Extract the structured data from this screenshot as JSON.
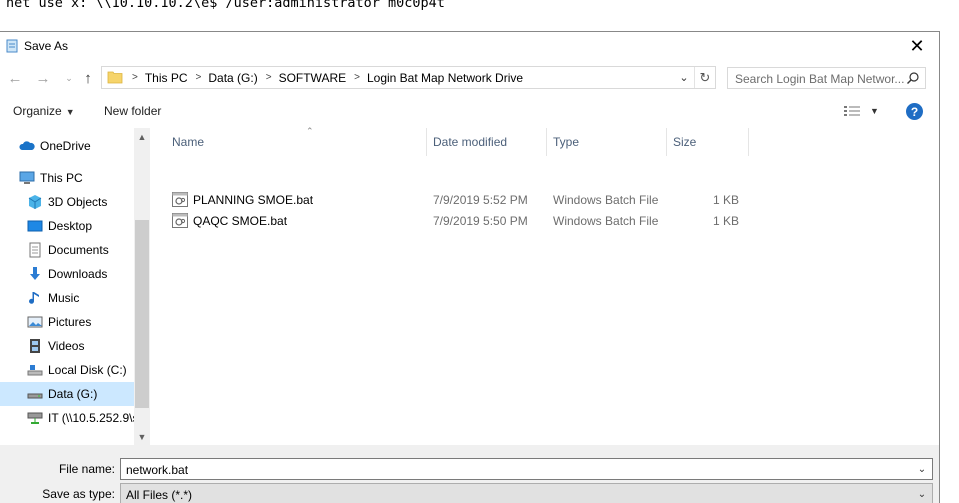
{
  "background": {
    "command_line": "net use x: \\\\10.10.10.2\\e$ /user:administrator m0c0p4t"
  },
  "dialog": {
    "title": "Save As"
  },
  "address": {
    "crumbs": [
      "This PC",
      "Data (G:)",
      "SOFTWARE",
      "Login Bat Map Network Drive"
    ]
  },
  "search": {
    "placeholder": "Search Login Bat Map Networ..."
  },
  "toolbar": {
    "organize_label": "Organize",
    "new_folder_label": "New folder"
  },
  "nav": {
    "items": [
      {
        "label": "OneDrive",
        "icon": "cloud-icon"
      },
      {
        "label": "This PC",
        "icon": "computer-icon"
      },
      {
        "label": "3D Objects",
        "icon": "cube-icon"
      },
      {
        "label": "Desktop",
        "icon": "desktop-icon"
      },
      {
        "label": "Documents",
        "icon": "document-icon"
      },
      {
        "label": "Downloads",
        "icon": "download-icon"
      },
      {
        "label": "Music",
        "icon": "music-note-icon"
      },
      {
        "label": "Pictures",
        "icon": "picture-icon"
      },
      {
        "label": "Videos",
        "icon": "film-icon"
      },
      {
        "label": "Local Disk (C:)",
        "icon": "drive-icon"
      },
      {
        "label": "Data (G:)",
        "icon": "drive-icon"
      },
      {
        "label": "IT (\\\\10.5.252.9\\s",
        "icon": "network-drive-icon"
      }
    ]
  },
  "columns": {
    "name": "Name",
    "date": "Date modified",
    "type": "Type",
    "size": "Size"
  },
  "files": [
    {
      "name": "PLANNING SMOE.bat",
      "date": "7/9/2019 5:52 PM",
      "type": "Windows Batch File",
      "size": "1 KB"
    },
    {
      "name": "QAQC SMOE.bat",
      "date": "7/9/2019 5:50 PM",
      "type": "Windows Batch File",
      "size": "1 KB"
    }
  ],
  "fields": {
    "file_name_label": "File name:",
    "file_name_value": "network.bat",
    "save_type_label": "Save as type:",
    "save_type_value": "All Files  (*.*)"
  },
  "colors": {
    "selected": "#cce8ff",
    "header_text": "#4c607a",
    "help_blue": "#1f6dc4"
  }
}
